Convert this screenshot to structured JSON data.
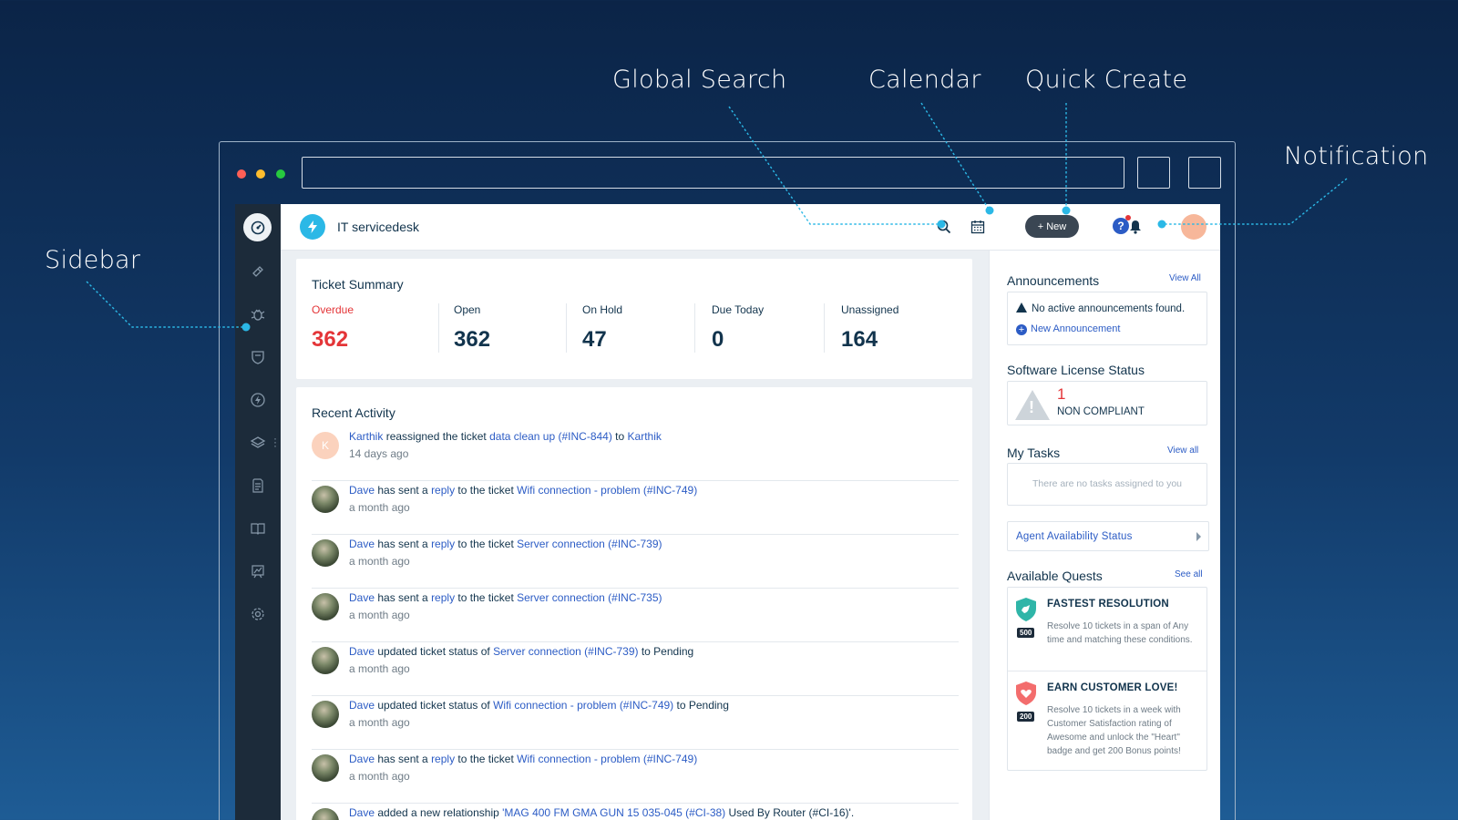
{
  "callouts": {
    "global_search": "Global Search",
    "calendar": "Calendar",
    "quick_create": "Quick Create",
    "notification": "Notification",
    "sidebar": "Sidebar"
  },
  "colors": {
    "callout_dot": "#2bb8e6",
    "accent_link": "#2c5cc5",
    "overdue": "#e43538",
    "sidebar_bg": "#1c2b3a"
  },
  "sidebar": {
    "items": [
      {
        "icon": "ticket-icon"
      },
      {
        "icon": "bug-icon"
      },
      {
        "icon": "shield-icon"
      },
      {
        "icon": "lightning-icon"
      },
      {
        "icon": "layers-icon"
      },
      {
        "icon": "document-icon"
      },
      {
        "icon": "book-icon"
      },
      {
        "icon": "chart-icon"
      },
      {
        "icon": "gear-icon"
      }
    ]
  },
  "header": {
    "app_title": "IT servicedesk",
    "new_button": "+ New",
    "help": "?"
  },
  "ticket_summary": {
    "title": "Ticket Summary",
    "stats": [
      {
        "label": "Overdue",
        "value": "362"
      },
      {
        "label": "Open",
        "value": "362"
      },
      {
        "label": "On Hold",
        "value": "47"
      },
      {
        "label": "Due Today",
        "value": "0"
      },
      {
        "label": "Unassigned",
        "value": "164"
      }
    ]
  },
  "recent_activity": {
    "title": "Recent Activity",
    "items": [
      {
        "avatar": "K",
        "user": "Karthik",
        "p1": " reassigned the ticket ",
        "link1": "data clean up (#INC-844)",
        "p2": " to ",
        "link2": "Karthik",
        "p3": "",
        "time": "14 days ago"
      },
      {
        "avatar": "",
        "user": "Dave",
        "p1": " has sent a ",
        "link1": "reply",
        "p2": " to the ticket ",
        "link2": "Wifi connection - problem (#INC-749)",
        "p3": "",
        "time": "a month ago"
      },
      {
        "avatar": "",
        "user": "Dave",
        "p1": " has sent a ",
        "link1": "reply",
        "p2": " to the ticket ",
        "link2": "Server connection (#INC-739)",
        "p3": "",
        "time": "a month ago"
      },
      {
        "avatar": "",
        "user": "Dave",
        "p1": " has sent a ",
        "link1": "reply",
        "p2": " to the ticket ",
        "link2": "Server connection (#INC-735)",
        "p3": "",
        "time": "a month ago"
      },
      {
        "avatar": "",
        "user": "Dave",
        "p1": " updated ticket status of ",
        "link1": "Server connection (#INC-739)",
        "p2": " to Pending",
        "link2": "",
        "p3": "",
        "time": "a month ago"
      },
      {
        "avatar": "",
        "user": "Dave",
        "p1": " updated ticket status of ",
        "link1": "Wifi connection - problem (#INC-749)",
        "p2": " to Pending",
        "link2": "",
        "p3": "",
        "time": "a month ago"
      },
      {
        "avatar": "",
        "user": "Dave",
        "p1": " has sent a ",
        "link1": "reply",
        "p2": " to the ticket ",
        "link2": "Wifi connection - problem (#INC-749)",
        "p3": "",
        "time": "a month ago"
      },
      {
        "avatar": "",
        "user": "Dave",
        "p1": " added a new relationship ",
        "link1": "'MAG 400 FM GMA GUN 15 035-045 (#CI-38)",
        "p2": " Used By Router (#CI-16)'.",
        "link2": "",
        "p3": "",
        "time": ""
      }
    ]
  },
  "announcements": {
    "title": "Announcements",
    "view_all": "View All",
    "empty": "No active announcements found.",
    "new": "New Announcement"
  },
  "license": {
    "title": "Software License Status",
    "count": "1",
    "status": "NON COMPLIANT"
  },
  "tasks": {
    "title": "My Tasks",
    "view_all": "View all",
    "empty": "There are no tasks assigned to you"
  },
  "agent_availability": "Agent Availability Status",
  "quests": {
    "title": "Available Quests",
    "see_all": "See all",
    "items": [
      {
        "name": "FASTEST RESOLUTION",
        "points": "500",
        "desc": "Resolve 10 tickets in a span of Any time and matching these conditions.",
        "color": "#2fb5a8"
      },
      {
        "name": "EARN CUSTOMER LOVE!",
        "points": "200",
        "desc": "Resolve 10 tickets in a week with Customer Satisfaction rating of Awesome and unlock the \"Heart\" badge and get 200 Bonus points!",
        "color": "#f36d6d"
      }
    ]
  }
}
